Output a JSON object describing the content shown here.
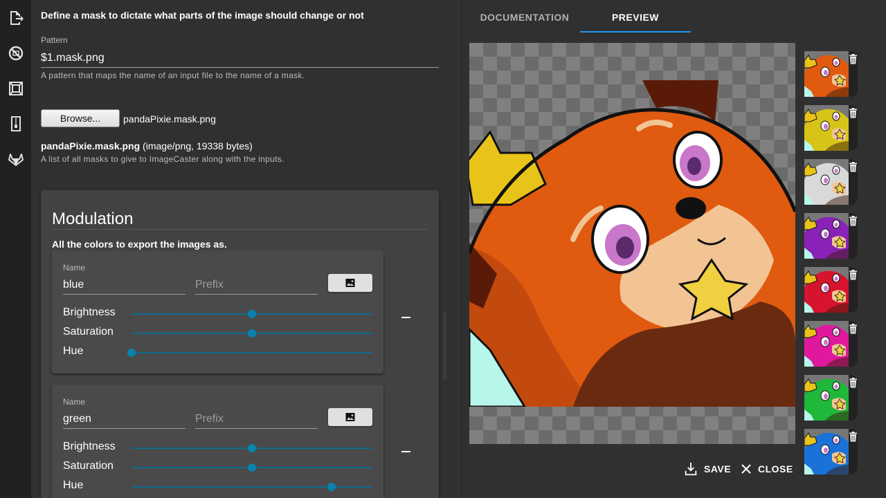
{
  "sidebar": {
    "items": [
      {
        "icon": "export-icon"
      },
      {
        "icon": "blocked-icon"
      },
      {
        "icon": "resize-icon"
      },
      {
        "icon": "archive-icon"
      },
      {
        "icon": "gitlab-icon"
      }
    ]
  },
  "mask": {
    "description": "Define a mask to dictate what parts of the image should change or not",
    "pattern_label": "Pattern",
    "pattern_value": "$1.mask.png",
    "pattern_help": "A pattern that maps the name of an input file to the name of a mask.",
    "browse_label": "Browse...",
    "browse_file": "pandaPixie.mask.png",
    "file_name": "pandaPixie.mask.png",
    "file_meta": " (image/png, 19338 bytes)",
    "file_help": "A list of all masks to give to ImageCaster along with the inputs."
  },
  "modulation": {
    "title": "Modulation",
    "subtitle": "All the colors to export the images as.",
    "colors": [
      {
        "name_label": "Name",
        "name": "blue",
        "prefix_placeholder": "Prefix",
        "brightness_label": "Brightness",
        "saturation_label": "Saturation",
        "hue_label": "Hue",
        "brightness": 0.5,
        "saturation": 0.5,
        "hue": 0.0
      },
      {
        "name_label": "Name",
        "name": "green",
        "prefix_placeholder": "Prefix",
        "brightness_label": "Brightness",
        "saturation_label": "Saturation",
        "hue_label": "Hue",
        "brightness": 0.5,
        "saturation": 0.5,
        "hue": 0.83
      }
    ]
  },
  "tabs": [
    {
      "label": "DOCUMENTATION",
      "active": false
    },
    {
      "label": "PREVIEW",
      "active": true
    }
  ],
  "actions": {
    "save_label": "SAVE",
    "close_label": "CLOSE"
  },
  "thumbnails": [
    {
      "color": "#e05a10"
    },
    {
      "color": "#d8c418"
    },
    {
      "color": "#d9d9d9"
    },
    {
      "color": "#8a22b8"
    },
    {
      "color": "#d8132e"
    },
    {
      "color": "#e0189e"
    },
    {
      "color": "#1fb83a"
    },
    {
      "color": "#1a72d8"
    }
  ],
  "colors": {
    "accent": "#2196f3",
    "slider": "#0a82ad",
    "fur_main": "#e05a10"
  }
}
